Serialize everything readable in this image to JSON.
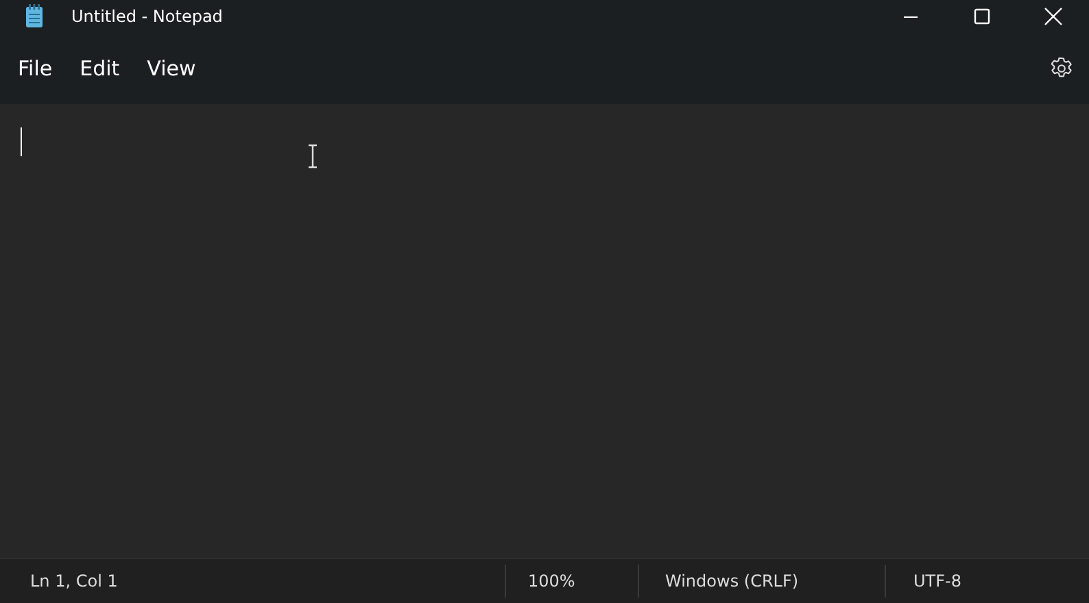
{
  "window": {
    "title": "Untitled - Notepad"
  },
  "menu": [
    "File",
    "Edit",
    "View"
  ],
  "status_bar": [
    "Ln 1, Col 1",
    "100%",
    "Windows (CRLF)",
    "UTF-8"
  ]
}
